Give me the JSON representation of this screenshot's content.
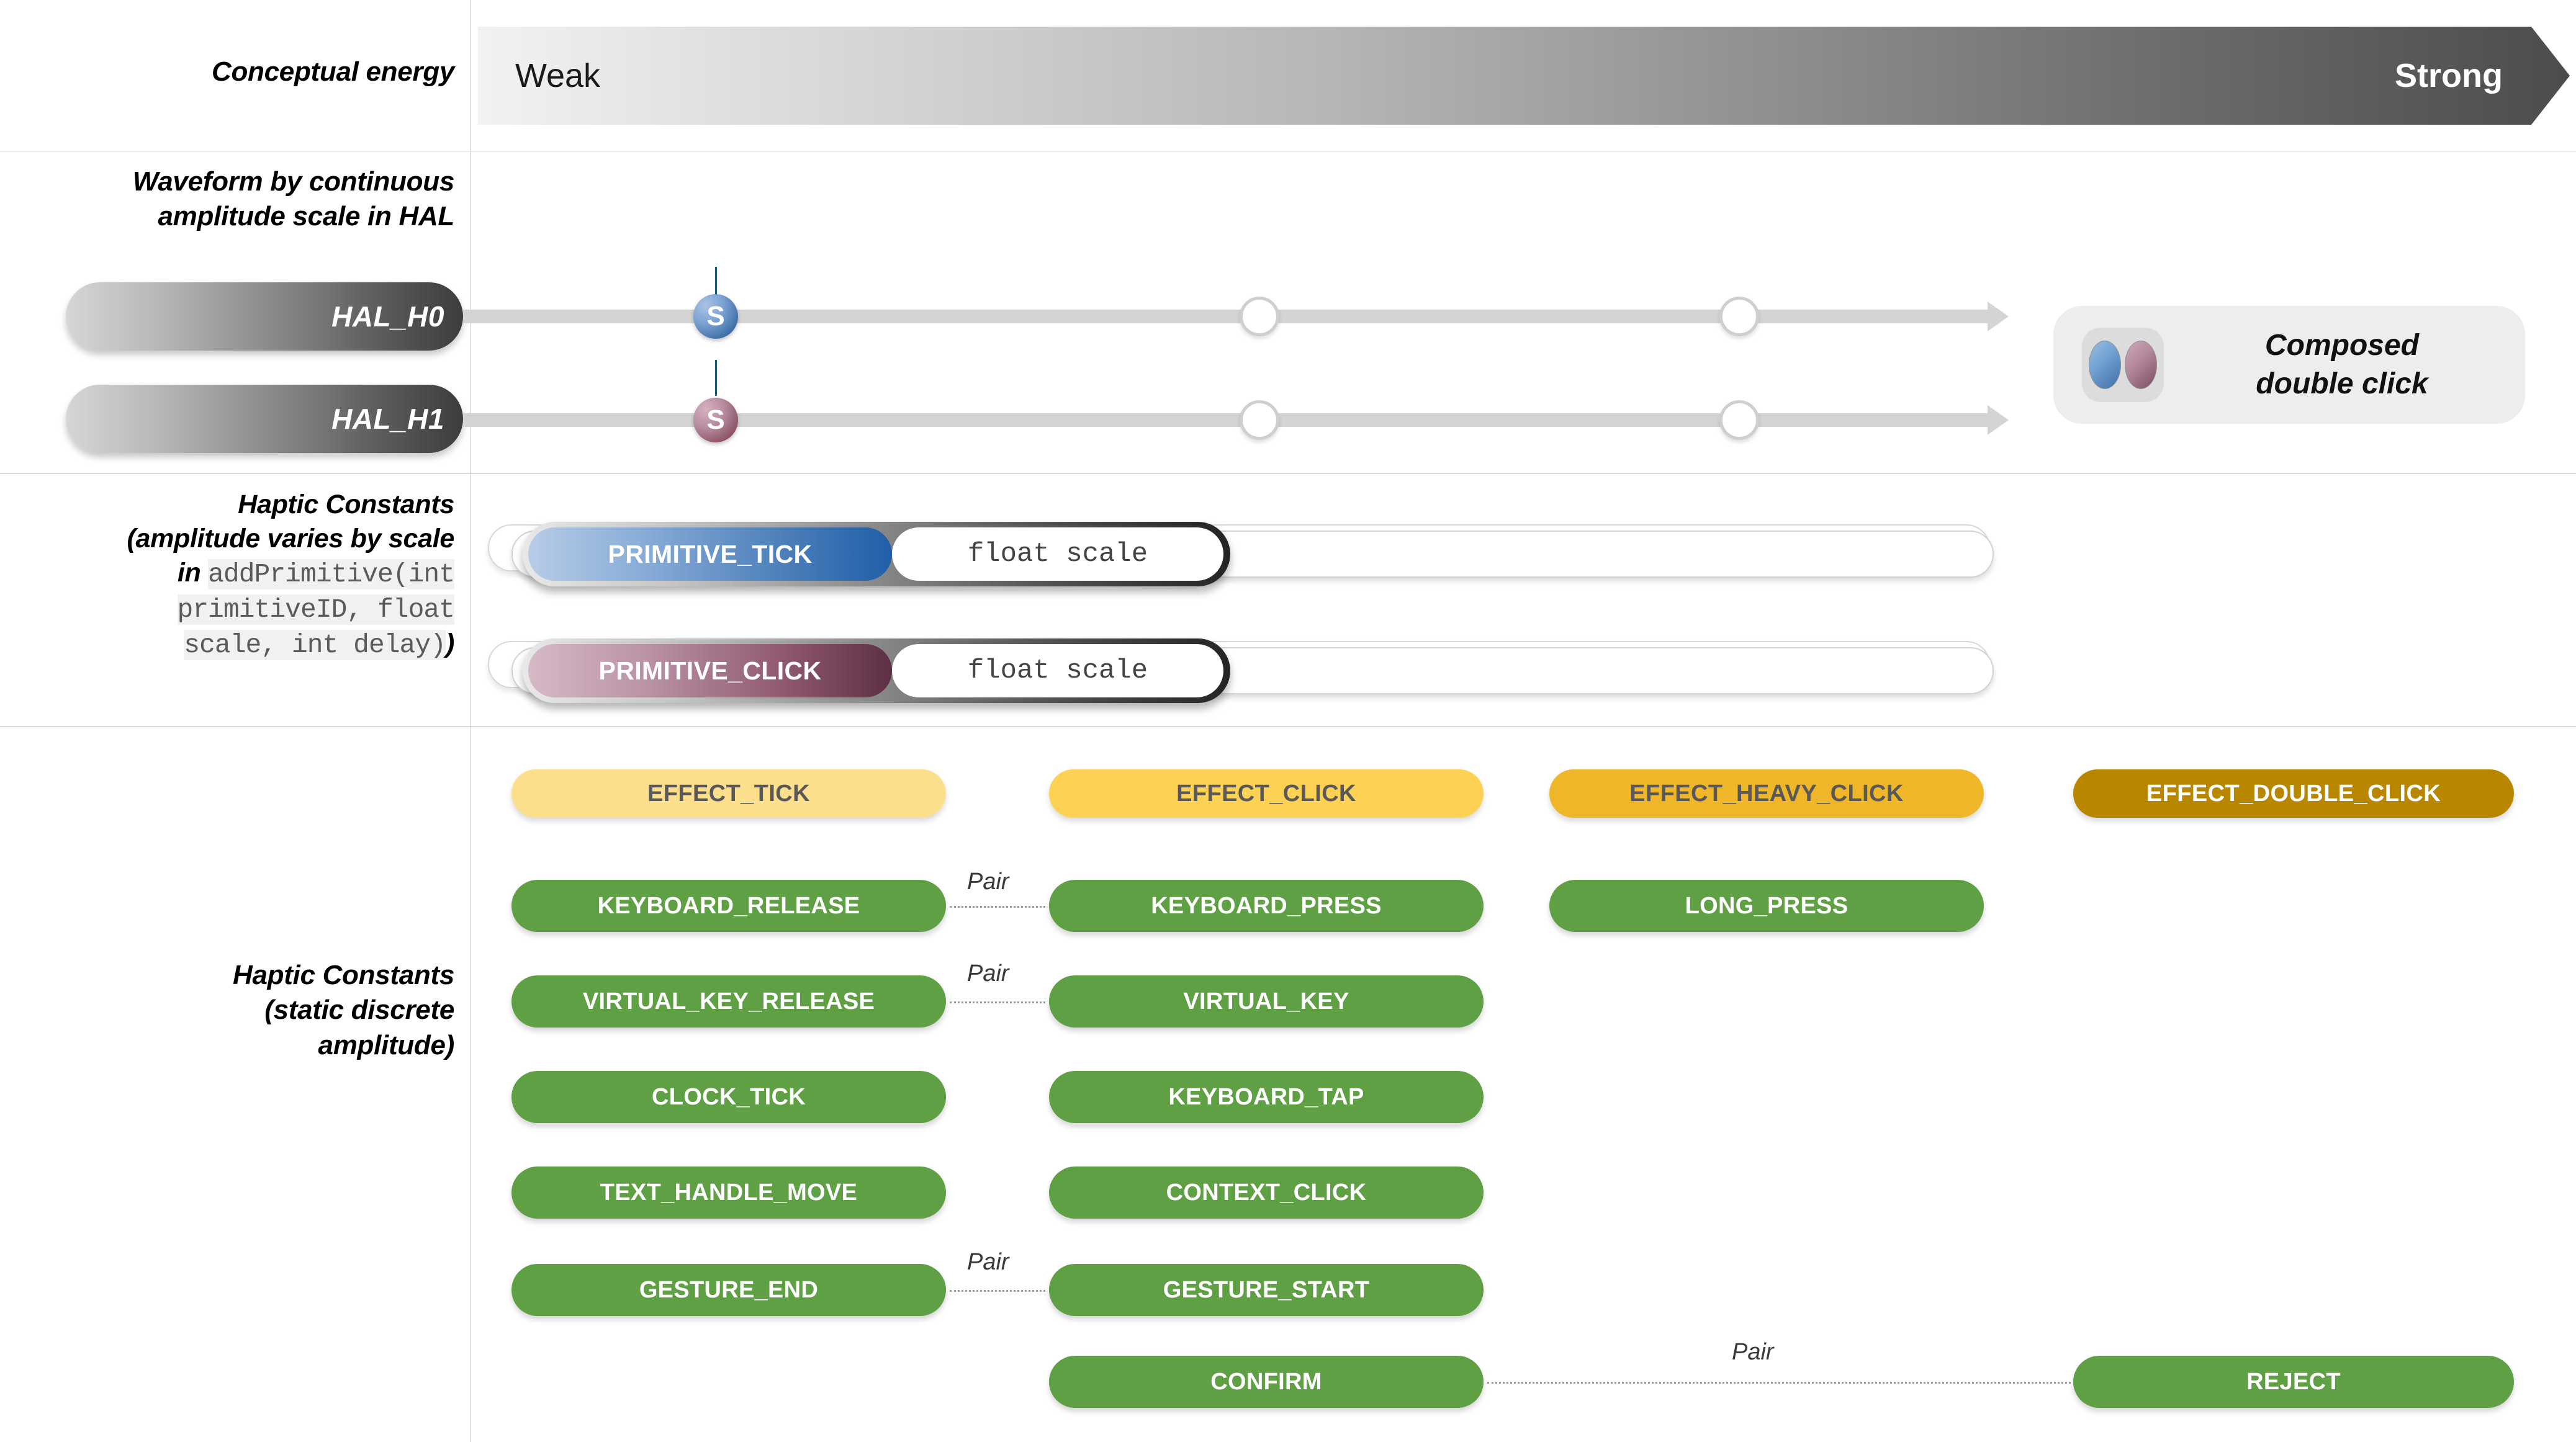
{
  "energy": {
    "label": "Conceptual energy",
    "weak": "Weak",
    "strong": "Strong"
  },
  "hal": {
    "label_line1": "Waveform by continuous",
    "label_line2": "amplitude scale in HAL",
    "rows": [
      {
        "name": "HAL_H0",
        "marker": "S",
        "marker_color": "#4d7fba"
      },
      {
        "name": "HAL_H1",
        "marker": "S",
        "marker_color": "#8c5368"
      }
    ],
    "composed": {
      "line1": "Composed",
      "line2": "double click"
    }
  },
  "primitives": {
    "label_l1": "Haptic Constants",
    "label_l2": "(amplitude varies by scale",
    "label_l3_pre": "in ",
    "label_code_1": "addPrimitive(int",
    "label_code_2": "primitiveID, float",
    "label_code_3": "scale, int delay)",
    "label_l4_post": ")",
    "rows": [
      {
        "name": "PRIMITIVE_TICK",
        "value": "float scale",
        "color": "#4d7fba"
      },
      {
        "name": "PRIMITIVE_CLICK",
        "value": "float scale",
        "color": "#8c5368"
      }
    ]
  },
  "constants": {
    "label_l1": "Haptic Constants",
    "label_l2": "(static discrete",
    "label_l3": "amplitude)",
    "effects": [
      {
        "name": "EFFECT_TICK",
        "bg": "#FCDF8C",
        "fg": "#585858"
      },
      {
        "name": "EFFECT_CLICK",
        "bg": "#FCD154",
        "fg": "#585858"
      },
      {
        "name": "EFFECT_HEAVY_CLICK",
        "bg": "#EFB62A",
        "fg": "#585858"
      },
      {
        "name": "EFFECT_DOUBLE_CLICK",
        "bg": "#B98600",
        "fg": "#ffffff"
      }
    ],
    "green": "#5FA045",
    "items": [
      {
        "name": "KEYBOARD_RELEASE",
        "col": 1,
        "row": 1
      },
      {
        "name": "KEYBOARD_PRESS",
        "col": 2,
        "row": 1
      },
      {
        "name": "LONG_PRESS",
        "col": 3,
        "row": 1
      },
      {
        "name": "VIRTUAL_KEY_RELEASE",
        "col": 1,
        "row": 2
      },
      {
        "name": "VIRTUAL_KEY",
        "col": 2,
        "row": 2
      },
      {
        "name": "CLOCK_TICK",
        "col": 1,
        "row": 3
      },
      {
        "name": "KEYBOARD_TAP",
        "col": 2,
        "row": 3
      },
      {
        "name": "TEXT_HANDLE_MOVE",
        "col": 1,
        "row": 4
      },
      {
        "name": "CONTEXT_CLICK",
        "col": 2,
        "row": 4
      },
      {
        "name": "GESTURE_END",
        "col": 1,
        "row": 5
      },
      {
        "name": "GESTURE_START",
        "col": 2,
        "row": 5
      },
      {
        "name": "CONFIRM",
        "col": 2,
        "row": 6
      },
      {
        "name": "REJECT",
        "col": 4,
        "row": 6
      }
    ],
    "pairs": [
      {
        "label": "Pair",
        "row": 1
      },
      {
        "label": "Pair",
        "row": 2
      },
      {
        "label": "Pair",
        "row": 5
      },
      {
        "label": "Pair",
        "row": 6
      }
    ]
  }
}
